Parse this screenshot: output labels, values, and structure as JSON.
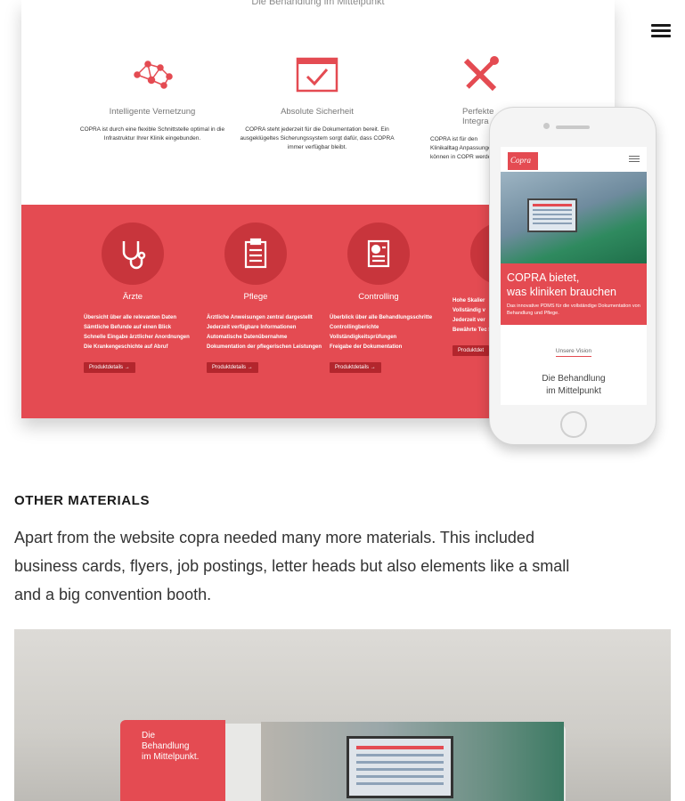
{
  "nav": {
    "menu_icon": "hamburger-menu-icon"
  },
  "mockup": {
    "top_title": "Die Behandlung im Mittelpunkt",
    "features": [
      {
        "icon": "network-icon",
        "title": "Intelligente Vernetzung",
        "desc": "COPRA ist durch eine flexible Schnittstelle optimal in die Infrastruktur Ihrer Klinik eingebunden."
      },
      {
        "icon": "checked-window-icon",
        "title": "Absolute Sicherheit",
        "desc": "COPRA steht jederzeit für die Dokumentation bereit. Ein ausgeklügeltes Sicherungssystem sorgt dafür, dass COPRA immer verfügbar bleibt."
      },
      {
        "icon": "tools-icon",
        "title": "Perfekte Integra",
        "desc": "COPRA ist für den Klinikalltag Anpassungen können in COPR werden"
      }
    ],
    "columns": [
      {
        "icon": "stethoscope-icon",
        "title": "Ärzte",
        "items": [
          "Übersicht über alle relevanten Daten",
          "Sämtliche Befunde auf einen Blick",
          "Schnelle Eingabe ärztlicher Anordnungen",
          "Die Krankengeschichte auf Abruf"
        ],
        "button": "Produktdetails →"
      },
      {
        "icon": "clipboard-icon",
        "title": "Pflege",
        "items": [
          "Ärztliche Anweisungen zentral dargestellt",
          "Jederzeit verfügbare Informationen",
          "Automatische Datenübernahme",
          "Dokumentation der pflegerischen Leistungen"
        ],
        "button": "Produktdetails →"
      },
      {
        "icon": "report-icon",
        "title": "Controlling",
        "items": [
          "Überblick über alle Behandlungsschritte",
          "Controllingberichte",
          "Vollständigkeitsprüfungen",
          "Freigabe der Dokumentation"
        ],
        "button": "Produktdetails →"
      },
      {
        "icon": "scale-icon",
        "title": "",
        "items": [
          "Hohe Skalier",
          "Vollständig v",
          "Jederzeit ver",
          "Bewährte Tec SQL-Server u Framework v"
        ],
        "button": "Produktdet"
      }
    ],
    "phone": {
      "logo": "Copra",
      "headline_1": "COPRA bietet,",
      "headline_2": "was kliniken brauchen",
      "sub": "Das innovative PDMS für die vollständige Dokumentation von Behandlung und Pflege.",
      "link": "Unsere Vision",
      "bottom_1": "Die Behandlung",
      "bottom_2": "im Mittelpunkt"
    }
  },
  "section": {
    "heading": "OTHER MATERIALS",
    "text": "Apart from the website copra needed many more materials. This included business cards, flyers, job postings, letter heads but also elements like a small and a big convention booth."
  },
  "booth": {
    "panel_text_1": "Die Behandlung",
    "panel_text_2": "im Mittelpunkt."
  },
  "colors": {
    "brand_red": "#e44b52",
    "dark_red": "#c8353c"
  }
}
